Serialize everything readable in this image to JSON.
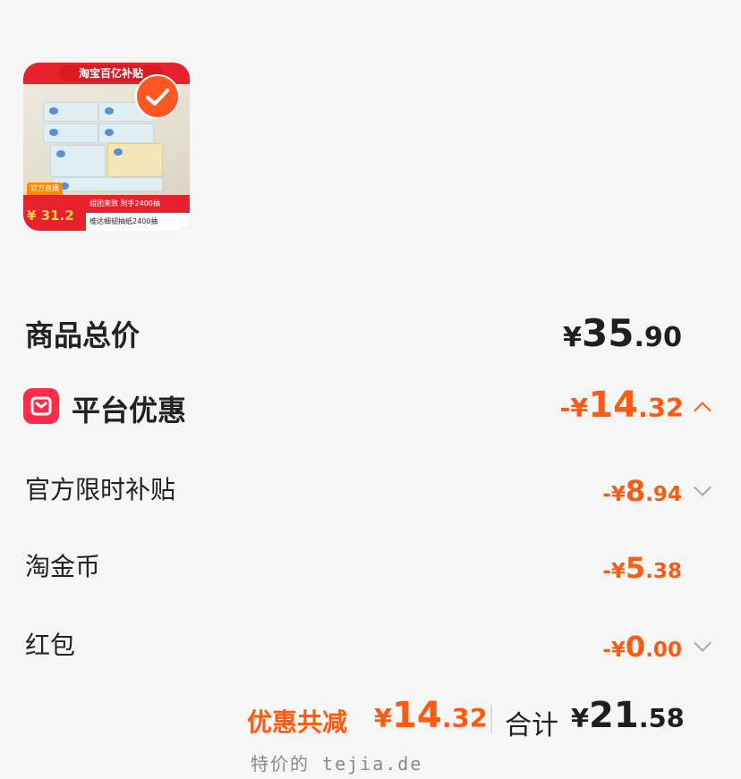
{
  "product": {
    "image_banner": "淘宝百亿补贴",
    "promo_price": "31.2",
    "promo_ribbon": "官方直播",
    "promo_line1": "组团来致 到手2400抽",
    "promo_line2": "维达细韧抽纸2400抽",
    "selected": true
  },
  "summary": {
    "goods_total_label": "商品总价",
    "goods_total_yen": "¥",
    "goods_total_int": "35",
    "goods_total_dec": ".90",
    "platform_label": "平台优惠",
    "platform_sign": "-¥",
    "platform_int": "14",
    "platform_dec": ".32",
    "items": [
      {
        "label": "官方限时补贴",
        "sign": "-¥",
        "int": "8",
        "dec": ".94",
        "expandable": true
      },
      {
        "label": "淘金币",
        "sign": "-¥",
        "int": "5",
        "dec": ".38",
        "expandable": false
      },
      {
        "label": "红包",
        "sign": "-¥",
        "int": "0",
        "dec": ".00",
        "expandable": true
      }
    ]
  },
  "footer": {
    "discount_label": "优惠共减",
    "discount_yen": "¥",
    "discount_int": "14",
    "discount_dec": ".32",
    "total_label": "合计",
    "total_yen": "¥",
    "total_int": "21",
    "total_dec": ".58",
    "watermark": "特价的 tejia.de"
  },
  "colors": {
    "accent": "#ff5a12",
    "platform_icon": "#ff2b4a",
    "background": "#f6f6f6"
  }
}
